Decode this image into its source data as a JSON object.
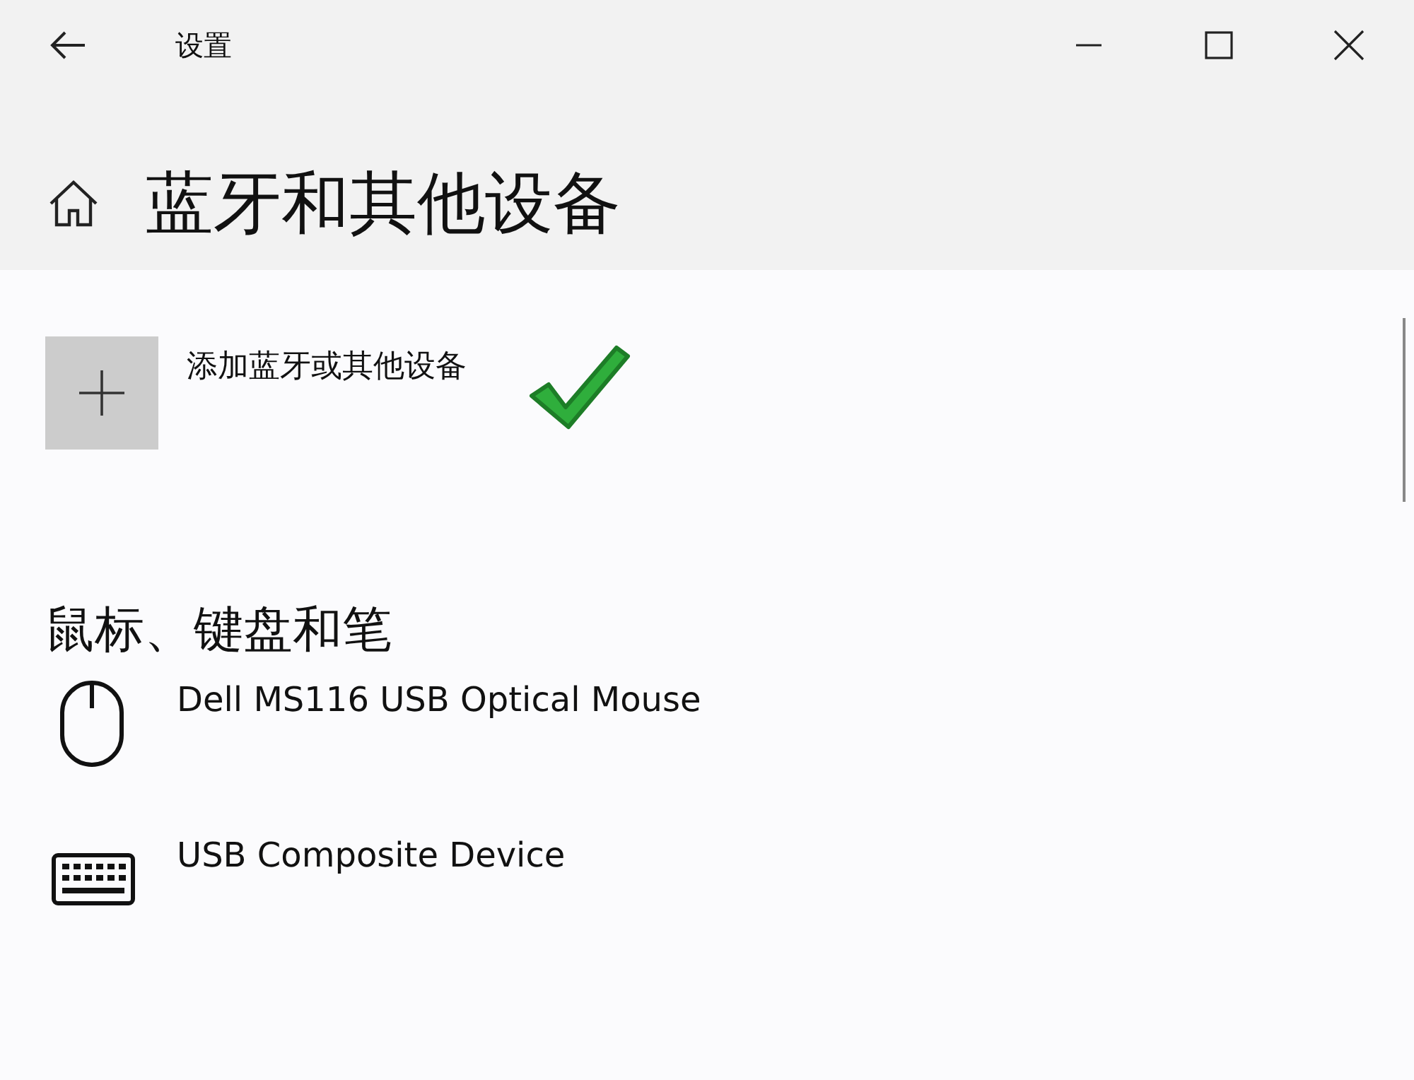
{
  "window": {
    "title": "设置"
  },
  "page": {
    "title": "蓝牙和其他设备"
  },
  "add_device": {
    "label": "添加蓝牙或其他设备"
  },
  "section": {
    "heading": "鼠标、键盘和笔"
  },
  "devices": [
    {
      "kind": "mouse",
      "name": "Dell MS116 USB Optical Mouse"
    },
    {
      "kind": "keyboard",
      "name": "USB Composite Device"
    }
  ]
}
